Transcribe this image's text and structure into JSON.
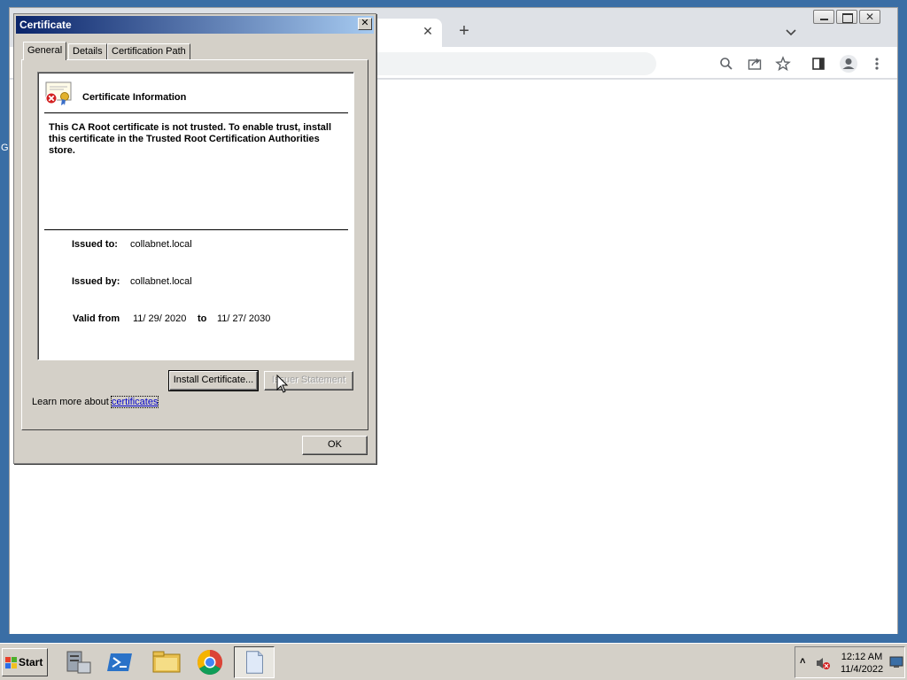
{
  "desktop": {
    "edge_glyph": "G"
  },
  "browser": {
    "tab_close": "✕",
    "new_tab": "+",
    "window_close": "✕"
  },
  "dialog": {
    "title": "Certificate",
    "close_label": "✕",
    "tabs": [
      {
        "label": "General",
        "active": true
      },
      {
        "label": "Details",
        "active": false
      },
      {
        "label": "Certification Path",
        "active": false
      }
    ],
    "info_heading": "Certificate Information",
    "warning": "This CA Root certificate is not trusted. To enable trust, install this certificate in the Trusted Root Certification Authorities store.",
    "issued_to_label": "Issued to:",
    "issued_to": "collabnet.local",
    "issued_by_label": "Issued by:",
    "issued_by": "collabnet.local",
    "valid_from_label": "Valid from",
    "valid_from": "11/ 29/ 2020",
    "to_label": "to",
    "valid_to": "11/ 27/ 2030",
    "install_button": "Install Certificate...",
    "issuer_statement_button": "Issuer Statement",
    "learn_more_prefix": "Learn more about ",
    "learn_more_link": "certificates",
    "ok_button": "OK"
  },
  "taskbar": {
    "start_label": "Start",
    "apps": [
      "server-manager-icon",
      "powershell-icon",
      "file-explorer-icon",
      "chrome-icon",
      "notepad-icon"
    ],
    "clock_time": "12:12 AM",
    "clock_date": "11/4/2022"
  }
}
